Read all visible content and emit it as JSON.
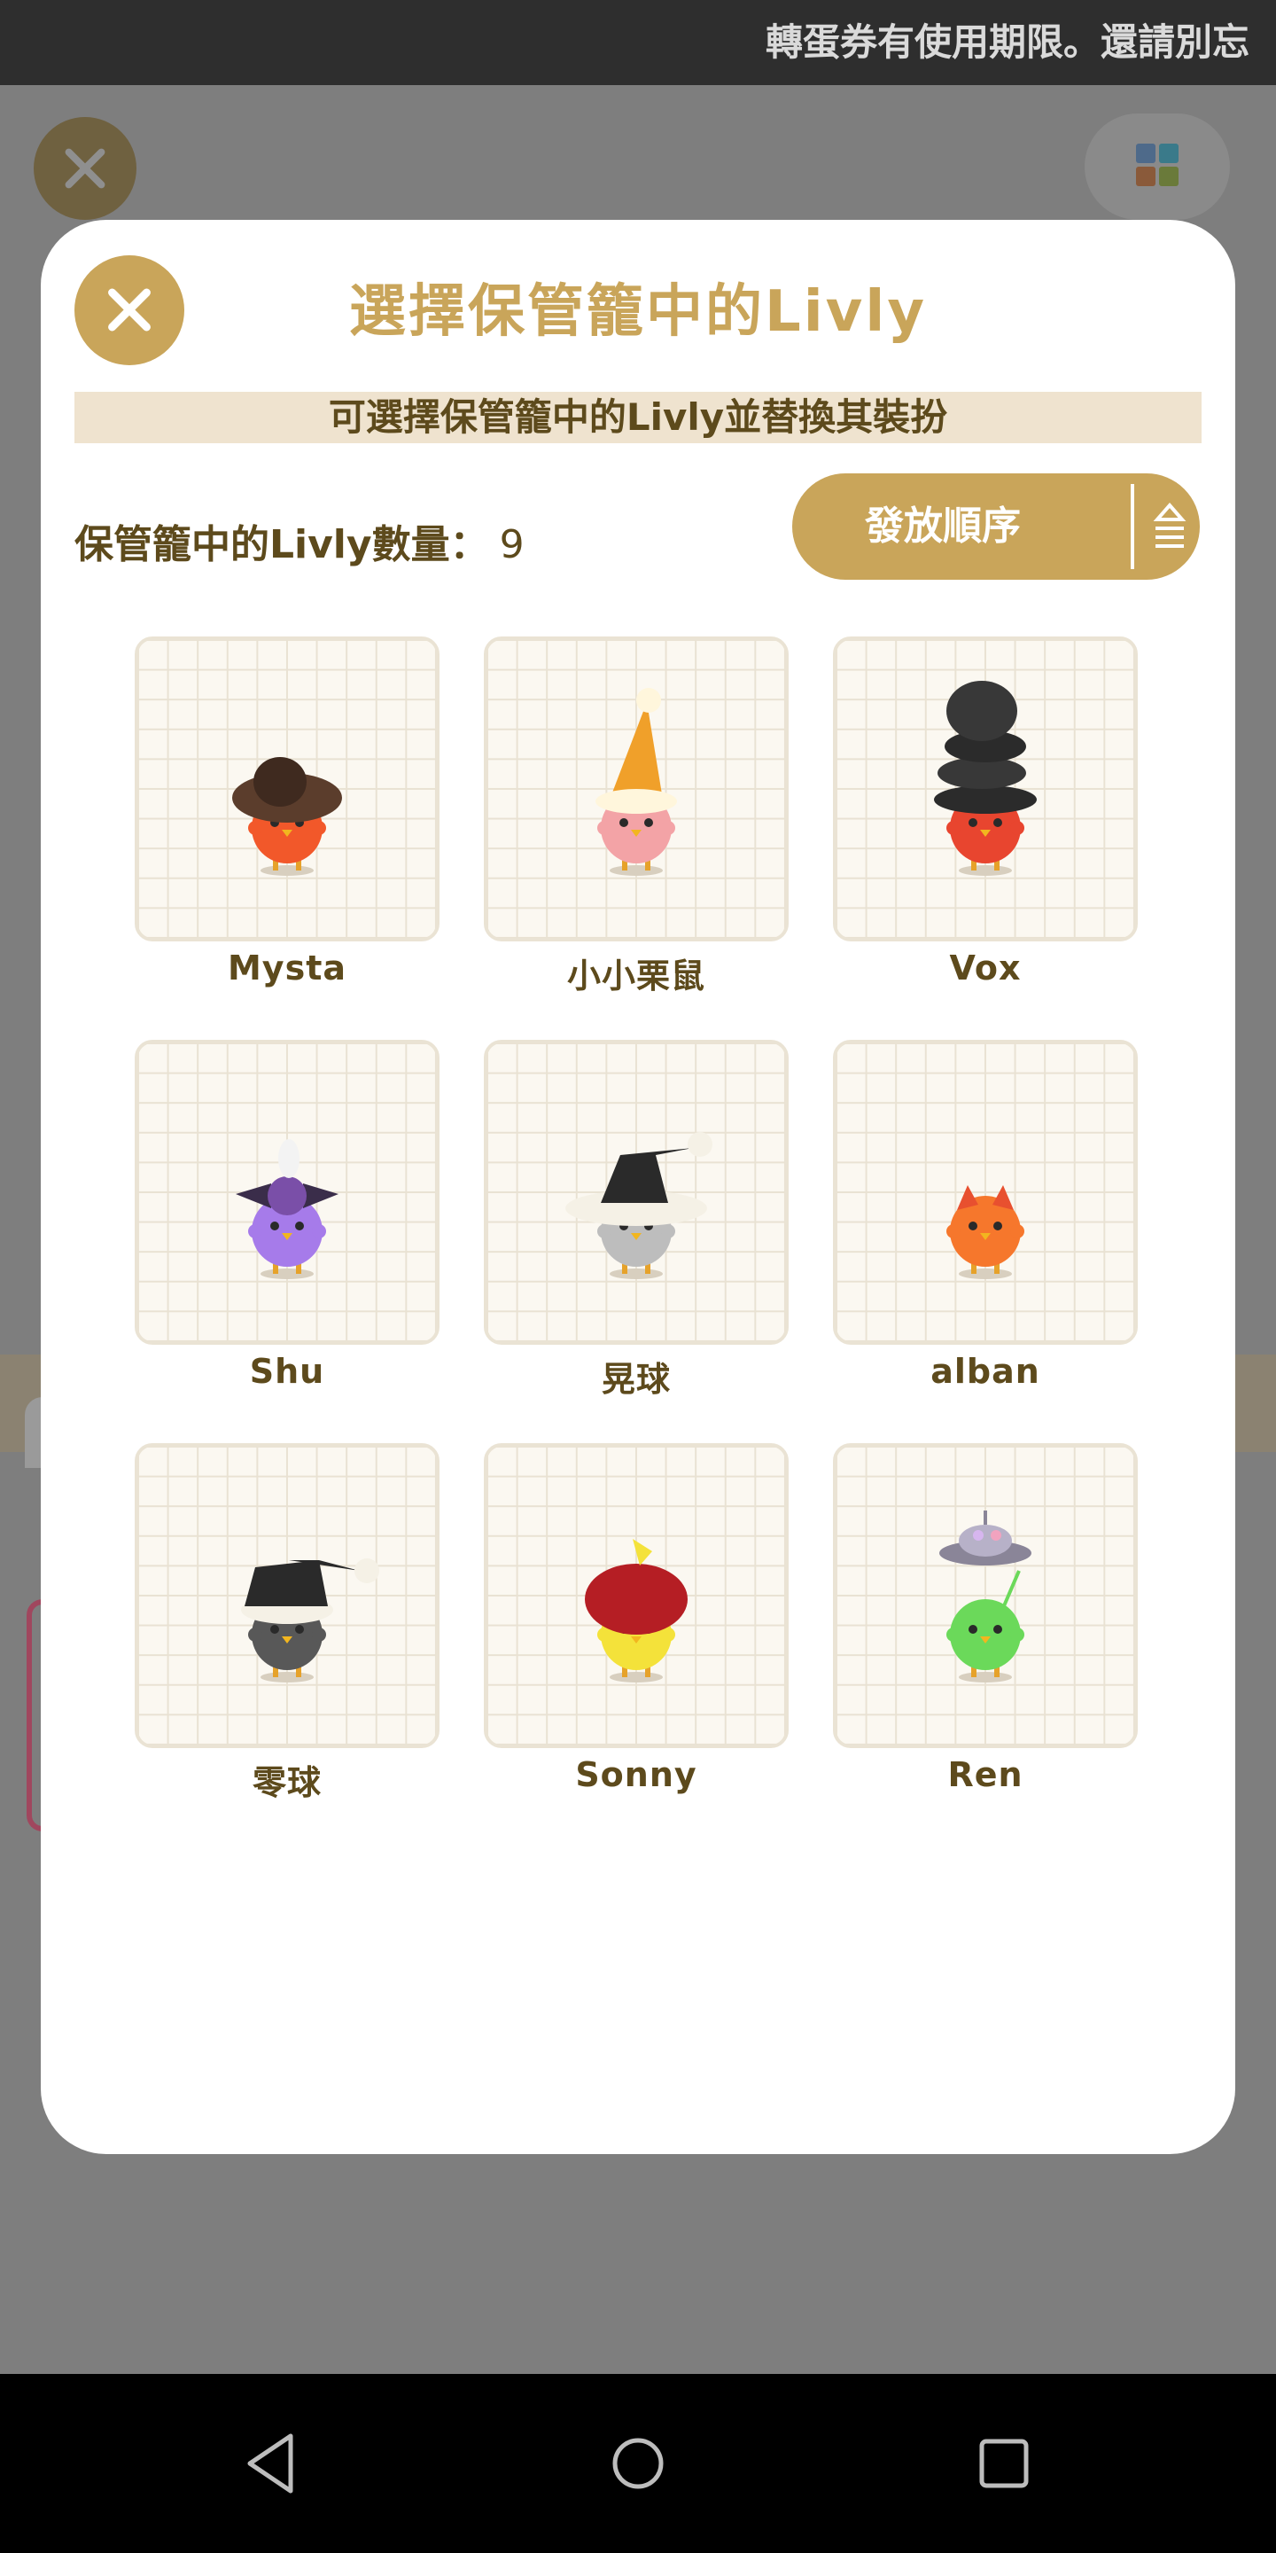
{
  "ticker": {
    "text": "轉蛋券有使用期限。還請別忘"
  },
  "modal": {
    "title": "選擇保管籠中的Livly",
    "subtitle": "可選擇保管籠中的Livly並替換其裝扮",
    "count_label": "保管籠中的Livly數量：",
    "count_value": "9",
    "sort_label": "發放順序"
  },
  "livlys": [
    {
      "name": "Mysta",
      "body": "#f2582a",
      "hat": "cap",
      "hat_color": "#5b3d2c"
    },
    {
      "name": "小小栗鼠",
      "body": "#f3a3a6",
      "hat": "party",
      "hat_color": "#f0a02a"
    },
    {
      "name": "Vox",
      "body": "#e8452f",
      "hat": "stack",
      "hat_color": "#2b2b2b"
    },
    {
      "name": "Shu",
      "body": "#a67bea",
      "hat": "bat",
      "hat_color": "#3a2d4a"
    },
    {
      "name": "晃球",
      "body": "#bdbdbd",
      "hat": "witch",
      "hat_color": "#2a2a2a"
    },
    {
      "name": "alban",
      "body": "#f6772c",
      "hat": "ears",
      "hat_color": "#e8502f"
    },
    {
      "name": "零球",
      "body": "#585858",
      "hat": "santa",
      "hat_color": "#2a2a2a"
    },
    {
      "name": "Sonny",
      "body": "#f4e23a",
      "hat": "beret",
      "hat_color": "#b51e24"
    },
    {
      "name": "Ren",
      "body": "#6bd95a",
      "hat": "ufo",
      "hat_color": "#8a8598"
    }
  ],
  "icons": {
    "close": "close-icon",
    "sort": "sort-order-icon",
    "menu": "grid-menu-icon",
    "nav": [
      "back-icon",
      "home-icon",
      "recents-icon"
    ]
  }
}
